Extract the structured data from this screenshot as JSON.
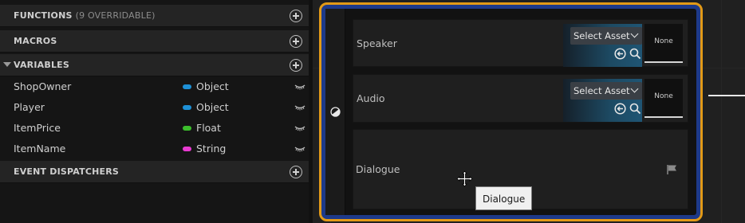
{
  "my_blueprint": {
    "functions": {
      "title": "FUNCTIONS",
      "count": "(9 OVERRIDABLE)"
    },
    "macros": {
      "title": "MACROS"
    },
    "variables": {
      "title": "VARIABLES",
      "items": [
        {
          "name": "ShopOwner",
          "type": "Object",
          "color": "#1e90d6"
        },
        {
          "name": "Player",
          "type": "Object",
          "color": "#1e90d6"
        },
        {
          "name": "ItemPrice",
          "type": "Float",
          "color": "#3cbe2c"
        },
        {
          "name": "ItemName",
          "type": "String",
          "color": "#e83ad0"
        }
      ]
    },
    "event_dispatchers": {
      "title": "EVENT DISPATCHERS"
    }
  },
  "node": {
    "rows": [
      {
        "label": "Speaker",
        "select_label": "Select Asset",
        "thumb_label": "None"
      },
      {
        "label": "Audio",
        "select_label": "Select Asset",
        "thumb_label": "None"
      },
      {
        "label": "Dialogue"
      }
    ],
    "tooltip": "Dialogue"
  },
  "colors": {
    "selection_outline": "#e39a16",
    "node_border": "#1e3a8a"
  }
}
